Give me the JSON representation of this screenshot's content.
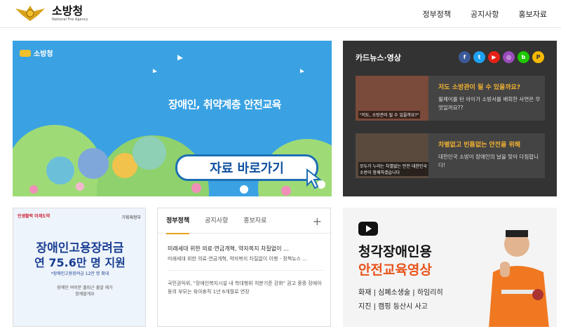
{
  "header": {
    "logo_ko": "소방청",
    "logo_en": "National Fire Agency",
    "nav": [
      "정부정책",
      "공지사항",
      "홍보자료"
    ]
  },
  "banner": {
    "logo": "소방청",
    "title": "장애인, 취약계층 안전교육",
    "cta": "자료 바로가기"
  },
  "card_news": {
    "heading": "카드뉴스·영상",
    "social": [
      {
        "icon": "facebook-icon",
        "label": "f",
        "color": "#3b5998"
      },
      {
        "icon": "twitter-icon",
        "label": "t",
        "color": "#1da1f2"
      },
      {
        "icon": "youtube-icon",
        "label": "▶",
        "color": "#e62117"
      },
      {
        "icon": "instagram-icon",
        "label": "◎",
        "color": "#9b4bbd"
      },
      {
        "icon": "blog-icon",
        "label": "b",
        "color": "#1ec800"
      },
      {
        "icon": "post-icon",
        "label": "P",
        "color": "#f5b900"
      }
    ],
    "items": [
      {
        "thumb_caption": "\"저도, 소방관이 될 수 있을까요?\"",
        "title": "저도 소방관이 될 수 있을까요?",
        "desc": "휠체어를 탄 아이가 소방서를 배회한 사연은 무엇일까요??"
      },
      {
        "thumb_caption": "모두가 누리는 차별없는 안전 대한민국 소방이 함께하겠습니다",
        "title": "차별없고 빈틈없는 안전을 위해",
        "desc": "대한민국 소방이 장애인의 날을 맞아 다짐합니다!"
      }
    ]
  },
  "poster": {
    "tag": "민생활력 미래도약",
    "ministry": "기획재정부",
    "line1": "장애인고용장려금",
    "line2": "연 75.6만 명 지원",
    "line3": "*장애인고용장려금 12만 명 확대",
    "hand": "장애인 여러분 출퇴근 출발 제가 함께할게요"
  },
  "tabs": {
    "labels": [
      "정부정책",
      "공지사항",
      "홍보자료"
    ],
    "plus": "+",
    "posts": [
      {
        "title": "미래세대 위한 의료·연금개혁, 약자복지 차질없이 …",
        "desc": "미래세대 위한 의료·연금개혁, 약자복지 차질없이 이행 - 정책뉴스 …"
      },
      {
        "title": "",
        "desc": "국민권익위, \"장애인복지시설 내 학대행위 처분기준 강화\" 권고 중증 장애아동의 부모는 육아휴직 1년 6개월로 연장"
      }
    ]
  },
  "video": {
    "line1": "청각장애인용",
    "line2": "안전교육영상",
    "line3": "화재 | 심폐소생술 | 하임리히",
    "line4": "지진 | 캠핑 등산시 사고"
  }
}
